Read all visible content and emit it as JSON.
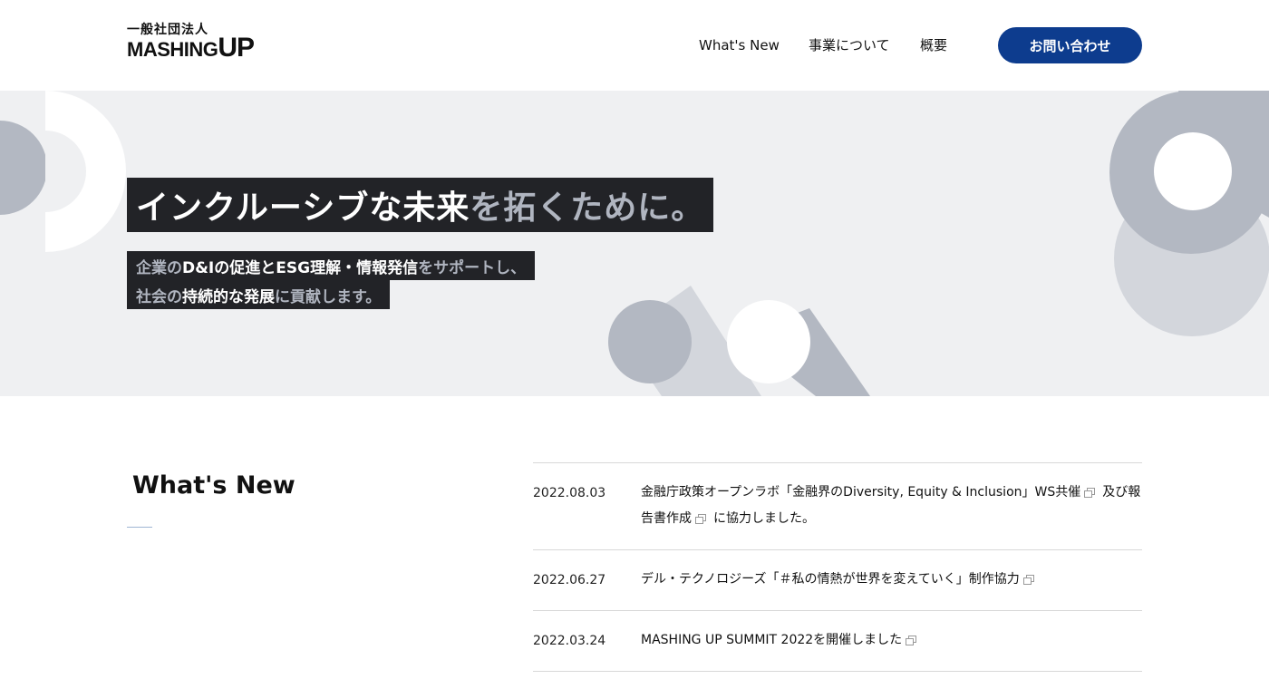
{
  "header": {
    "logo_org": "一般社団法人",
    "logo_name_main": "MASHING",
    "logo_name_up": "UP",
    "nav": [
      "What's New",
      "事業について",
      "概要"
    ],
    "contact_label": "お問い合わせ"
  },
  "hero": {
    "title_bright": "インクルーシブな未来",
    "title_dim": "を拓くために。",
    "sub1_parts": [
      "企業の",
      "D&Iの促進と",
      "ESG理解・情報発信",
      "をサポートし、"
    ],
    "sub2_parts": [
      "社会の",
      "持続的な発展",
      "に貢献します。"
    ]
  },
  "news": {
    "heading": "What's New",
    "items": [
      {
        "date": "2022.08.03",
        "text_a": "金融庁政策オープンラボ「金融界のDiversity, Equity & Inclusion」WS共催",
        "text_b": "及び報告書作成",
        "text_c": "に協力しました。"
      },
      {
        "date": "2022.06.27",
        "text_a": "デル・テクノロジーズ「＃私の情熱が世界を変えていく」制作協力"
      },
      {
        "date": "2022.03.24",
        "text_a": "MASHING UP SUMMIT 2022を開催しました"
      }
    ]
  },
  "colors": {
    "accent": "#0d3c8e",
    "hero_bg": "#eff0f2",
    "label_bg": "#222327",
    "shape_dark": "#b3b8c2",
    "shape_light": "#d3d6dc"
  }
}
